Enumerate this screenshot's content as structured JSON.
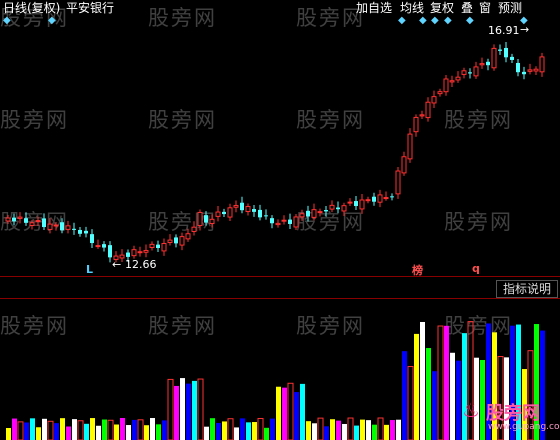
{
  "header": {
    "period": "日线(复权)",
    "stock_name": "平安银行",
    "menu": [
      "加自选",
      "均线",
      "复权",
      "叠",
      "窗",
      "预测"
    ]
  },
  "chart": {
    "high_label": "16.91",
    "low_label": "12.66",
    "marker_l": "L",
    "marker_bang": "榜",
    "marker_q": "q",
    "indicator_button": "指标说明"
  },
  "watermark": {
    "text": "股旁网",
    "logo_text": "股旁网",
    "logo_sub": "www.gupang.com"
  },
  "colors": {
    "up": "#ff3232",
    "down": "#54ffff",
    "background": "#000000",
    "vol_yellow": "#ffff00",
    "vol_magenta": "#ff00ff",
    "vol_white": "#ffffff",
    "vol_green": "#00ff00",
    "vol_blue": "#0000ff"
  }
}
